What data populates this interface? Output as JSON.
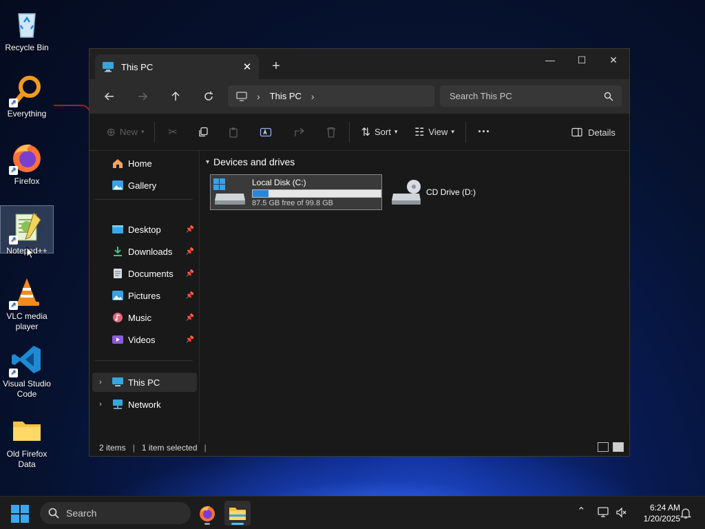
{
  "desktop": {
    "icons": [
      {
        "label": "Recycle Bin"
      },
      {
        "label": "Everything"
      },
      {
        "label": "Firefox"
      },
      {
        "label": "Notepad++"
      },
      {
        "label": "VLC media player"
      },
      {
        "label": "Visual Studio Code"
      },
      {
        "label": "Old Firefox Data"
      }
    ]
  },
  "window": {
    "tab_title": "This PC",
    "new_tab_glyph": "+",
    "controls": {
      "minimize": "—",
      "maximize": "☐",
      "close": "✕"
    },
    "address": {
      "segment": "This PC"
    },
    "search": {
      "placeholder": "Search This PC"
    },
    "toolbar": {
      "new_label": "New",
      "sort_label": "Sort",
      "view_label": "View",
      "more_label": "···",
      "details_label": "Details"
    },
    "sidebar": {
      "quick": [
        {
          "label": "Home"
        },
        {
          "label": "Gallery"
        }
      ],
      "pinned": [
        {
          "label": "Desktop"
        },
        {
          "label": "Downloads"
        },
        {
          "label": "Documents"
        },
        {
          "label": "Pictures"
        },
        {
          "label": "Music"
        },
        {
          "label": "Videos"
        }
      ],
      "locations": [
        {
          "label": "This PC"
        },
        {
          "label": "Network"
        }
      ]
    },
    "content": {
      "group_header": "Devices and drives",
      "drives": [
        {
          "name": "Local Disk (C:)",
          "free_text": "87.5 GB free of 99.8 GB",
          "used_fraction": 0.123
        },
        {
          "name": "CD Drive (D:)"
        }
      ]
    },
    "status": {
      "items": "2 items",
      "selected": "1 item selected"
    }
  },
  "taskbar": {
    "search_label": "Search",
    "time": "6:24 AM",
    "date": "1/20/2025"
  },
  "colors": {
    "accent": "#2a86d8",
    "folder": "#f5c445"
  }
}
